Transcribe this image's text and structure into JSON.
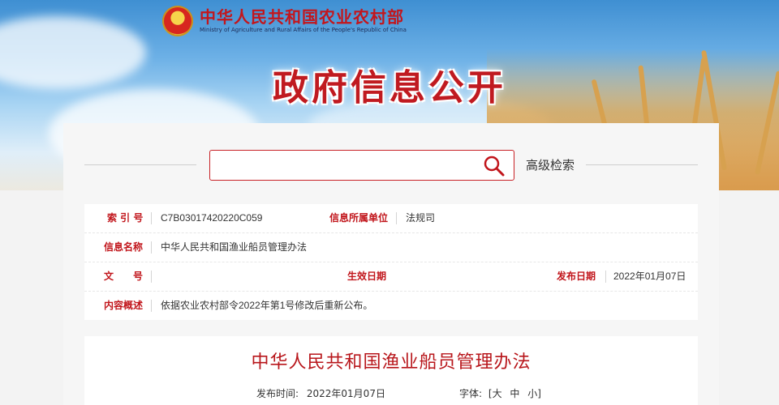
{
  "header": {
    "ministry_cn": "中华人民共和国农业农村部",
    "ministry_en": "Ministry of Agriculture and Rural Affairs of the People's Republic of China",
    "banner_title": "政府信息公开"
  },
  "search": {
    "value": "",
    "placeholder": "",
    "advanced_label": "高级检索"
  },
  "info": {
    "index_label": "索 引 号",
    "index_value": "C7B03017420220C059",
    "unit_label": "信息所属单位",
    "unit_value": "法规司",
    "name_label": "信息名称",
    "name_value": "中华人民共和国渔业船员管理办法",
    "doc_no_label": "文　　号",
    "doc_no_value": "",
    "effective_label": "生效日期",
    "effective_value": "",
    "publish_label": "发布日期",
    "publish_value": "2022年01月07日",
    "summary_label": "内容概述",
    "summary_value": "依据农业农村部令2022年第1号修改后重新公布。"
  },
  "article": {
    "title": "中华人民共和国渔业船员管理办法",
    "publish_time_label": "发布时间:",
    "publish_time_value": "2022年01月07日",
    "font_label": "字体:",
    "font_bracket_open": "[",
    "font_large": "大",
    "font_medium": "中",
    "font_small": "小",
    "font_bracket_close": "]"
  },
  "colors": {
    "brand_red": "#c1151b",
    "sky_blue": "#6cb0e6",
    "wheat_gold": "#d99b4d"
  },
  "icons": {
    "search": "search-icon",
    "emblem": "national-emblem-icon"
  }
}
